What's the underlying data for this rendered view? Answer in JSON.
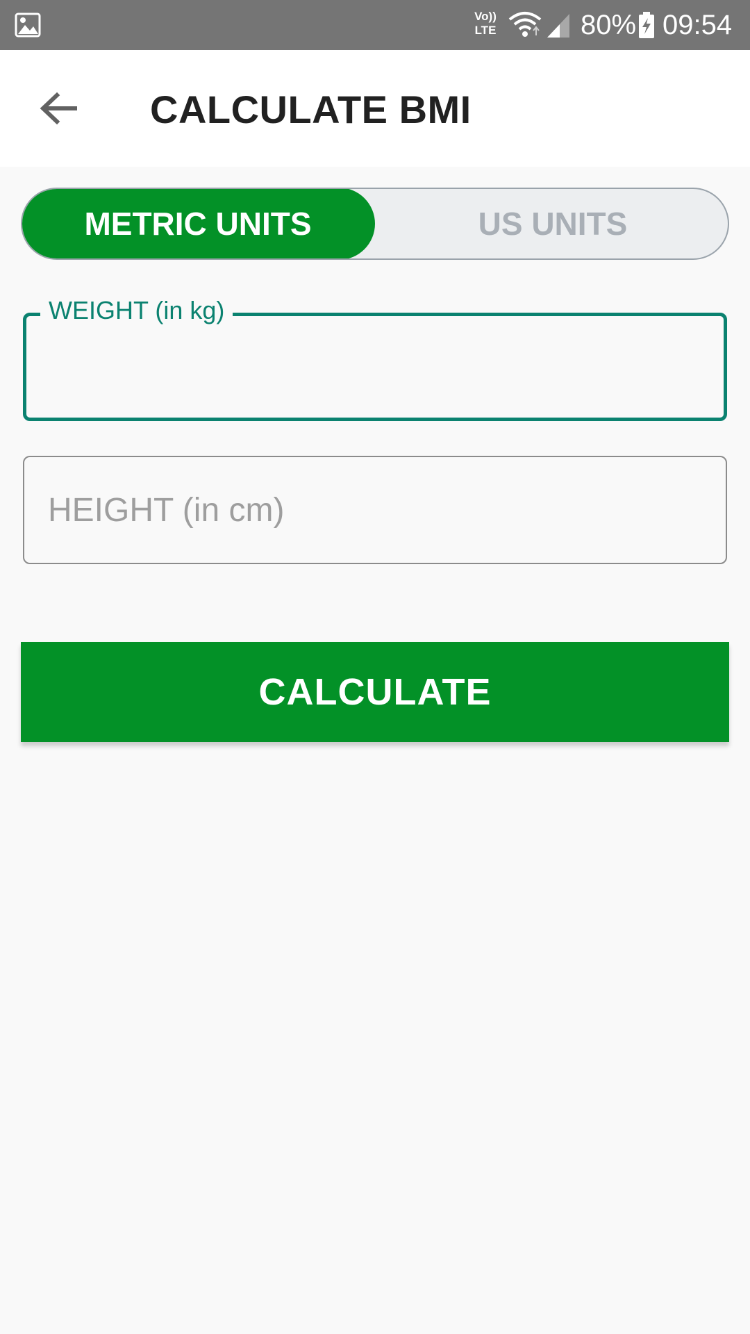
{
  "status_bar": {
    "volte_line1": "Vo))",
    "volte_line2": "LTE",
    "battery_percent": "80%",
    "time": "09:54",
    "icons": [
      "gallery-icon",
      "volte-icon",
      "wifi-icon",
      "signal-icon",
      "battery-charging-icon"
    ]
  },
  "toolbar": {
    "title": "CALCULATE BMI",
    "back_icon": "arrow-left-icon"
  },
  "unit_toggle": {
    "options": [
      {
        "label": "METRIC UNITS",
        "selected": true
      },
      {
        "label": "US UNITS",
        "selected": false
      }
    ]
  },
  "form": {
    "weight": {
      "label": "WEIGHT (in kg)",
      "value": "",
      "focused": true
    },
    "height": {
      "placeholder": "HEIGHT (in cm)",
      "value": ""
    }
  },
  "calculate_button": {
    "label": "CALCULATE"
  },
  "colors": {
    "primary_green": "#039127",
    "focus_teal": "#0b8270",
    "status_bar": "#757575",
    "background": "#f9f9f9"
  }
}
